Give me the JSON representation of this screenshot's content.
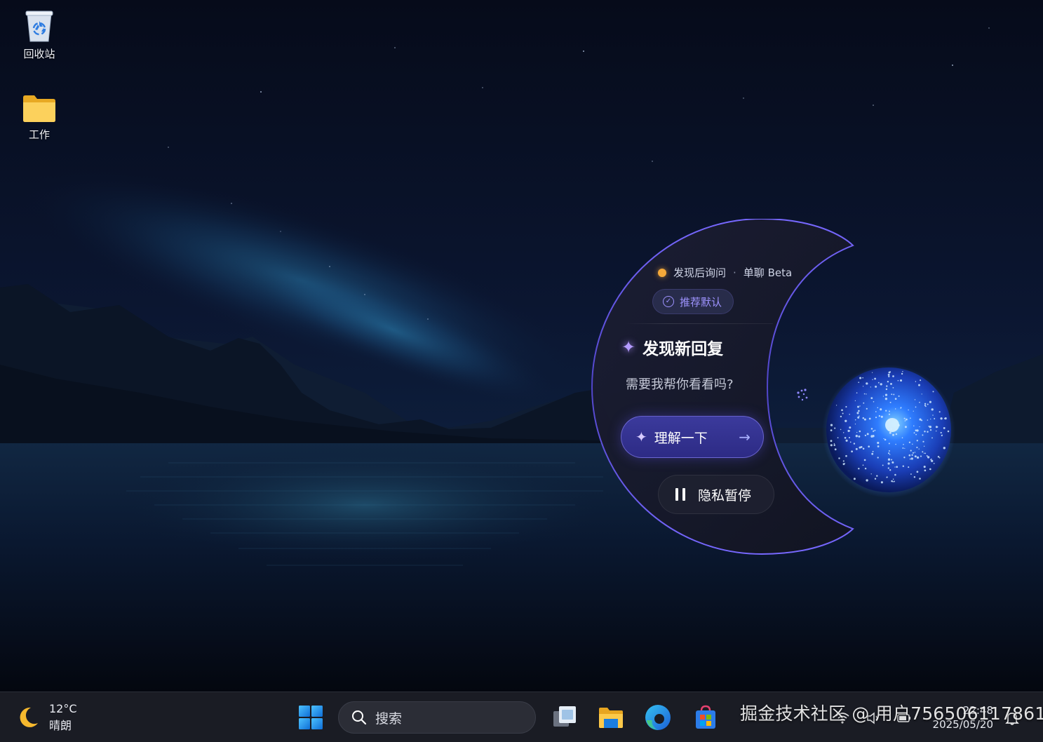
{
  "desktop": {
    "icons": [
      {
        "label": "回收站",
        "icon": "recycle-bin-icon"
      },
      {
        "label": "工作",
        "icon": "folder-icon"
      }
    ]
  },
  "assistant": {
    "status": "发现后询问",
    "separator": "·",
    "mode": "单聊 Beta",
    "recommend_label": "推荐默认",
    "title": "发现新回复",
    "subtitle": "需要我帮你看看吗?",
    "understand_label": "理解一下",
    "pause_label": "隐私暂停",
    "colors": {
      "accent": "#9e93ff",
      "status_dot": "#f5a93a",
      "button": "#3b3a9c"
    }
  },
  "taskbar": {
    "weather": {
      "temp": "12°C",
      "condition": "晴朗",
      "icon": "moon-icon"
    },
    "search_placeholder": "搜索",
    "apps": [
      "desktop-app-icon",
      "file-explorer-icon",
      "edge-icon",
      "store-icon"
    ],
    "clock": {
      "time": "22:48",
      "date": "2025/05/20"
    }
  },
  "watermark": "掘金技术社区 @ 用户7565061178611"
}
